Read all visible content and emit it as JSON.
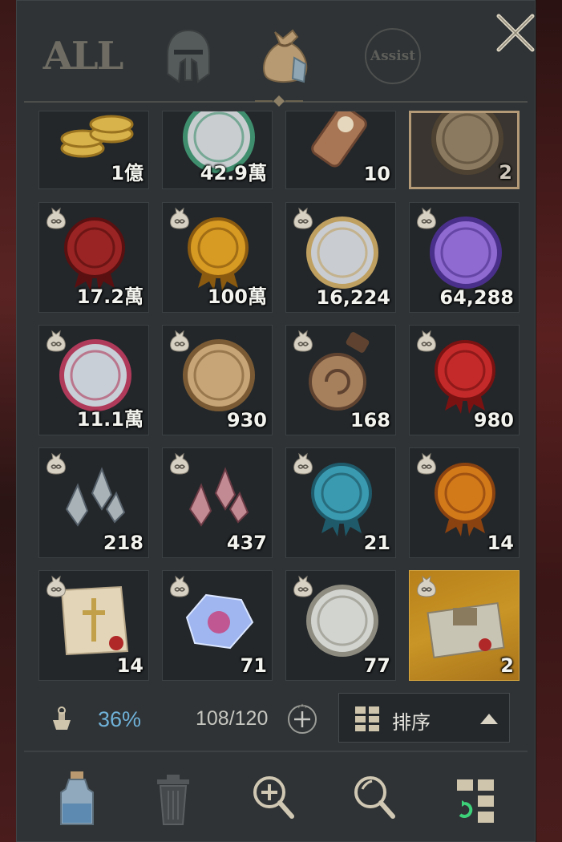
{
  "header": {
    "tabs": [
      {
        "id": "all",
        "label": "ALL",
        "active": false
      },
      {
        "id": "equipment",
        "icon": "helmet-icon",
        "active": false
      },
      {
        "id": "inventory",
        "icon": "money-bag-icon",
        "active": true
      },
      {
        "id": "assist",
        "label": "Assist",
        "active": false
      }
    ],
    "close_icon": "close-icon"
  },
  "items": [
    {
      "row": 0,
      "col": 0,
      "name": "gold-coins",
      "count": "1億",
      "bag": false,
      "cut": true
    },
    {
      "row": 0,
      "col": 1,
      "name": "silver-swords-coin",
      "count": "42.9萬",
      "bag": false,
      "cut": true
    },
    {
      "row": 0,
      "col": 2,
      "name": "paw-scroll",
      "count": "10",
      "bag": false,
      "cut": true
    },
    {
      "row": 0,
      "col": 3,
      "name": "paw-medallion",
      "count": "2",
      "bag": false,
      "cut": true,
      "selected": true
    },
    {
      "row": 1,
      "col": 0,
      "name": "lion-seal",
      "count": "17.2萬",
      "bag": true
    },
    {
      "row": 1,
      "col": 1,
      "name": "gold-figure-seal",
      "count": "100萬",
      "bag": true
    },
    {
      "row": 1,
      "col": 2,
      "name": "archer-coin",
      "count": "16,224",
      "bag": true
    },
    {
      "row": 1,
      "col": 3,
      "name": "purple-card-coin",
      "count": "64,288",
      "bag": true
    },
    {
      "row": 2,
      "col": 0,
      "name": "fleur-coin",
      "count": "11.1萬",
      "bag": true
    },
    {
      "row": 2,
      "col": 1,
      "name": "bronze-dragon-coin",
      "count": "930",
      "bag": true
    },
    {
      "row": 2,
      "col": 2,
      "name": "triskele-amulet",
      "count": "168",
      "bag": true
    },
    {
      "row": 2,
      "col": 3,
      "name": "crossed-swords-seal",
      "count": "980",
      "bag": true
    },
    {
      "row": 3,
      "col": 0,
      "name": "silver-crystals",
      "count": "218",
      "bag": true
    },
    {
      "row": 3,
      "col": 1,
      "name": "pink-crystals",
      "count": "437",
      "bag": true
    },
    {
      "row": 3,
      "col": 2,
      "name": "infinity-seal",
      "count": "21",
      "bag": true
    },
    {
      "row": 3,
      "col": 3,
      "name": "lv-seal",
      "count": "14",
      "bag": true
    },
    {
      "row": 4,
      "col": 0,
      "name": "cross-parchment",
      "count": "14",
      "bag": true
    },
    {
      "row": 4,
      "col": 1,
      "name": "prismatic-gem",
      "count": "71",
      "bag": true
    },
    {
      "row": 4,
      "col": 2,
      "name": "silver-cross-coin",
      "count": "77",
      "bag": true
    },
    {
      "row": 4,
      "col": 3,
      "name": "treasure-deed",
      "count": "2",
      "bag": true,
      "gold": true
    }
  ],
  "status": {
    "weight_icon": "weight-icon",
    "weight_percent": "36%",
    "weight_fraction": 0.36,
    "slots": "108/120",
    "slots_used": 108,
    "slots_total": 120,
    "expand_icon": "plus-circle-icon"
  },
  "sort": {
    "label": "排序",
    "icon": "grid-icon",
    "chevron": "chevron-up-icon"
  },
  "bottom_bar": [
    {
      "id": "potion",
      "icon": "potion-bottle-icon"
    },
    {
      "id": "discard",
      "icon": "trash-can-icon"
    },
    {
      "id": "zoom-in",
      "icon": "magnify-plus-icon"
    },
    {
      "id": "search",
      "icon": "magnify-icon"
    },
    {
      "id": "arrange",
      "icon": "grid-refresh-icon"
    }
  ],
  "colors": {
    "panel": "#2f3335",
    "slot": "#23272a",
    "percent_text": "#6fb1d8",
    "gold_slot": "#c99526"
  }
}
